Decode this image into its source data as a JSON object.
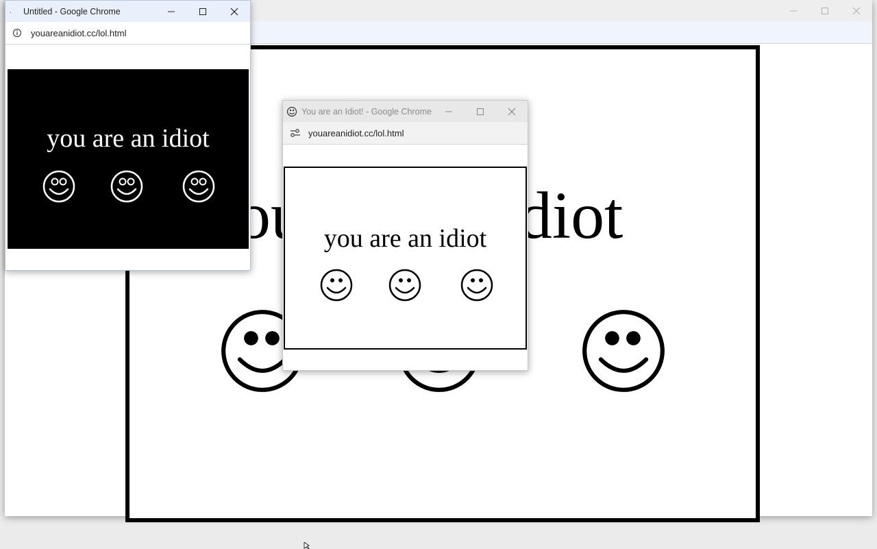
{
  "back_window": {
    "ctrl_color": "#b0b0b0",
    "heading": "you are an idiot"
  },
  "left_window": {
    "title": "Untitled - Google Chrome",
    "url": "youareanidiot.cc/lol.html",
    "heading": "you are an idiot",
    "page_bg": "#000000",
    "text_color": "#ffffff",
    "titlebar_color": "#e9f0fb"
  },
  "popup_window": {
    "title": "You are an Idiot! - Google Chrome",
    "url": "youareanidiot.cc/lol.html",
    "heading": "you are an idiot",
    "page_bg": "#ffffff",
    "text_color": "#000000",
    "titlebar_color": "#e8e8e8"
  }
}
